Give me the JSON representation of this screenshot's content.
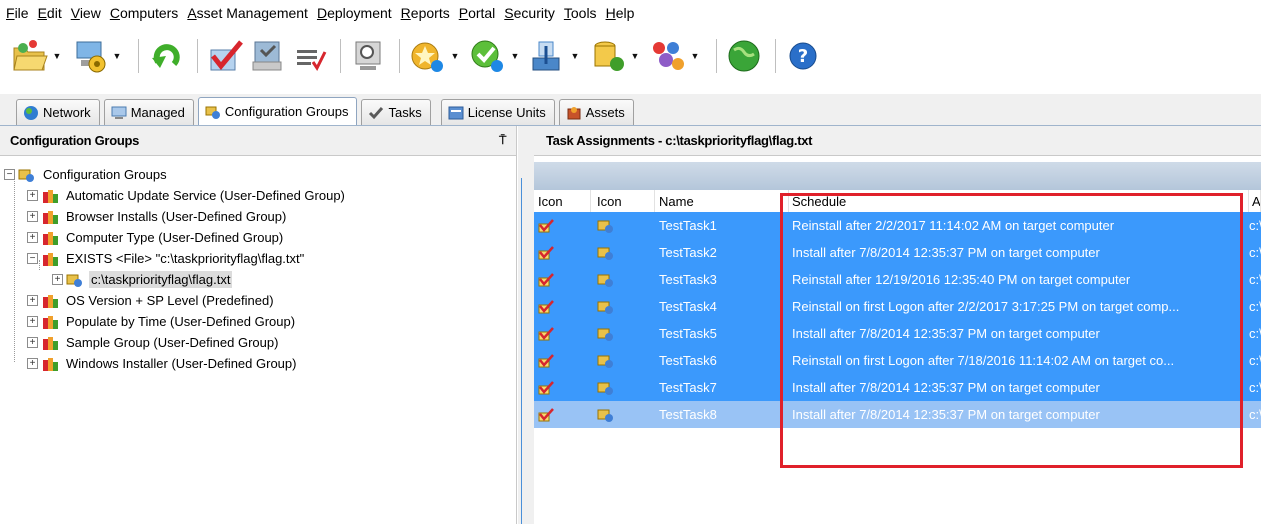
{
  "menu": [
    "File",
    "Edit",
    "View",
    "Computers",
    "Asset Management",
    "Deployment",
    "Reports",
    "Portal",
    "Security",
    "Tools",
    "Help"
  ],
  "toolbar": {
    "icons": [
      "open-folder-icon",
      "computer-settings-icon",
      "refresh-icon",
      "checkmark-task-icon",
      "task-list-icon",
      "edit-tasks-icon",
      "search-computer-icon",
      "star-package-icon",
      "deploy-package-icon",
      "install-icon",
      "database-package-icon",
      "network-package-icon",
      "portal-globe-icon",
      "help-icon"
    ]
  },
  "tabs": [
    {
      "label": "Network",
      "icon": "globe-icon"
    },
    {
      "label": "Managed",
      "icon": "computer-icon"
    },
    {
      "label": "Configuration Groups",
      "icon": "config-groups-icon",
      "active": true
    },
    {
      "label": "Tasks",
      "icon": "task-check-icon"
    },
    {
      "label": "License Units",
      "icon": "license-units-icon"
    },
    {
      "label": "Assets",
      "icon": "assets-icon"
    }
  ],
  "left_panel": {
    "title": "Configuration Groups",
    "pin": "⍑",
    "tree": {
      "root": "Configuration Groups",
      "groups": [
        "Automatic Update Service (User-Defined Group)",
        "Browser Installs (User-Defined Group)",
        "Computer Type (User-Defined Group)",
        "EXISTS <File> \"c:\\taskpriorityflag\\flag.txt\"",
        "OS Version + SP Level (Predefined)",
        "Populate by Time (User-Defined Group)",
        "Sample Group (User-Defined Group)",
        "Windows Installer (User-Defined Group)"
      ],
      "child": "c:\\taskpriorityflag\\flag.txt"
    }
  },
  "right_panel": {
    "title": "Task Assignments - c:\\taskpriorityflag\\flag.txt",
    "columns": [
      "Icon",
      "Icon",
      "Name",
      "Schedule",
      "As"
    ],
    "rows": [
      {
        "name": "TestTask1",
        "schedule": "Reinstall after 2/2/2017 11:14:02 AM on target computer",
        "as": "c:\\"
      },
      {
        "name": "TestTask2",
        "schedule": "Install after 7/8/2014 12:35:37 PM on target computer",
        "as": "c:\\"
      },
      {
        "name": "TestTask3",
        "schedule": "Reinstall after 12/19/2016 12:35:40 PM on target computer",
        "as": "c:\\"
      },
      {
        "name": "TestTask4",
        "schedule": "Reinstall on first Logon after 2/2/2017 3:17:25 PM on target comp...",
        "as": "c:\\"
      },
      {
        "name": "TestTask5",
        "schedule": "Install after 7/8/2014 12:35:37 PM on target computer",
        "as": "c:\\"
      },
      {
        "name": "TestTask6",
        "schedule": "Reinstall on first Logon after 7/18/2016 11:14:02 AM on target co...",
        "as": "c:\\"
      },
      {
        "name": "TestTask7",
        "schedule": "Install after 7/8/2014 12:35:37 PM on target computer",
        "as": "c:\\"
      },
      {
        "name": "TestTask8",
        "schedule": "Install after 7/8/2014 12:35:37 PM on target computer",
        "as": "c:\\"
      }
    ]
  },
  "colors": {
    "selection": "#3b99fc",
    "selection_inactive": "#99c3f5",
    "highlight_border": "#e0202a",
    "group_band": "#c3d2e3"
  }
}
